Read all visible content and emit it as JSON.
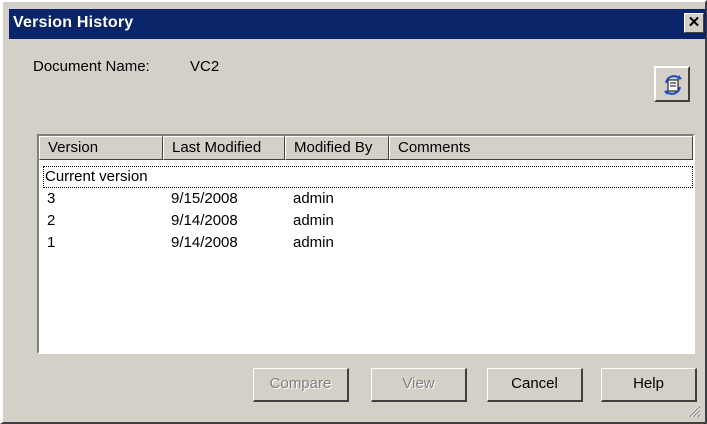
{
  "window": {
    "title": "Version History"
  },
  "document": {
    "label": "Document Name:",
    "value": "VC2"
  },
  "list": {
    "columns": [
      "Version",
      "Last Modified",
      "Modified By",
      "Comments"
    ],
    "current_row": "Current version",
    "rows": [
      {
        "version": "3",
        "last_modified": "9/15/2008",
        "modified_by": "admin",
        "comments": ""
      },
      {
        "version": "2",
        "last_modified": "9/14/2008",
        "modified_by": "admin",
        "comments": ""
      },
      {
        "version": "1",
        "last_modified": "9/14/2008",
        "modified_by": "admin",
        "comments": ""
      }
    ]
  },
  "buttons": {
    "compare": {
      "label": "Compare",
      "enabled": false
    },
    "view": {
      "label": "View",
      "enabled": false
    },
    "cancel": {
      "label": "Cancel",
      "enabled": true
    },
    "help": {
      "label": "Help",
      "enabled": true
    }
  },
  "icons": {
    "close": "close-icon",
    "refresh": "refresh-icon",
    "resize": "resize-grip-icon"
  },
  "colors": {
    "titlebar": "#0a246a",
    "face": "#d4d0c8",
    "disabled_text": "#808080"
  }
}
